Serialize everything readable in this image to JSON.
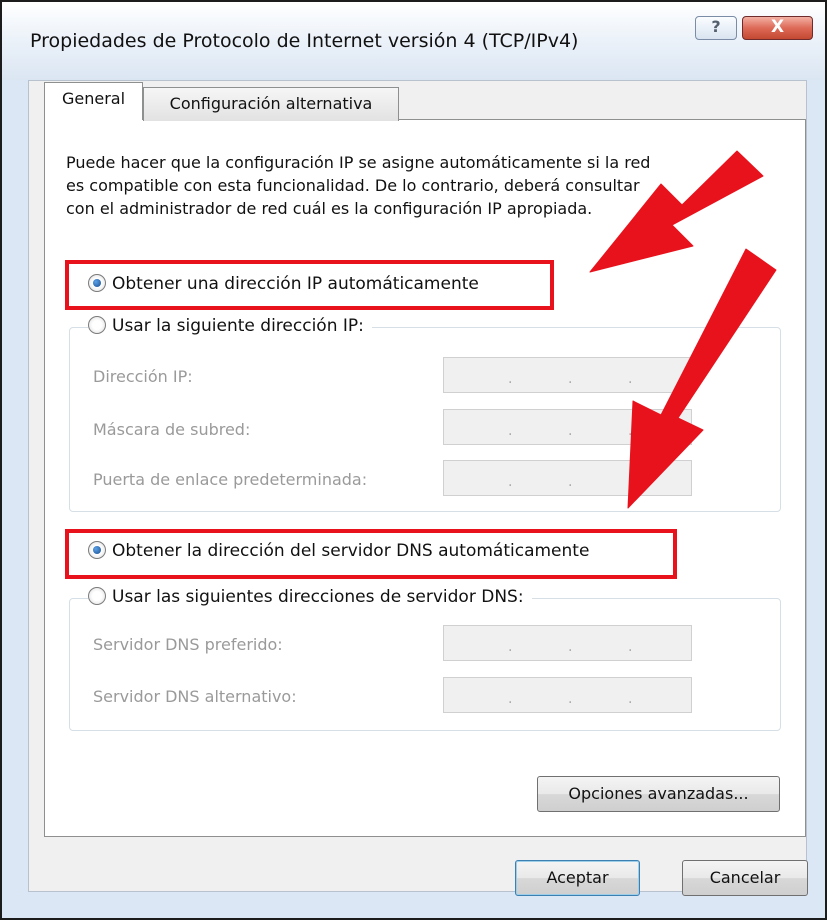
{
  "window": {
    "title": "Propiedades de Protocolo de Internet versión 4 (TCP/IPv4)",
    "help_label": "?",
    "close_label": "X"
  },
  "tabs": [
    {
      "label": "General",
      "selected": true
    },
    {
      "label": "Configuración alternativa",
      "selected": false
    }
  ],
  "intro_lines": [
    "Puede hacer que la configuración IP se asigne automáticamente si la red",
    "es compatible con esta funcionalidad. De lo contrario, deberá consultar",
    "con el administrador de red cuál es la configuración IP apropiada."
  ],
  "ip_section": {
    "auto_label": "Obtener una dirección IP automáticamente",
    "auto_selected": true,
    "manual_label": "Usar la siguiente dirección IP:",
    "fields": [
      {
        "label": "Dirección IP:",
        "value": ". . ."
      },
      {
        "label": "Máscara de subred:",
        "value": ". . ."
      },
      {
        "label": "Puerta de enlace predeterminada:",
        "value": ". . ."
      }
    ]
  },
  "dns_section": {
    "auto_label": "Obtener la dirección del servidor DNS automáticamente",
    "auto_selected": true,
    "manual_label": "Usar las siguientes direcciones de servidor DNS:",
    "fields": [
      {
        "label": "Servidor DNS preferido:",
        "value": ". . ."
      },
      {
        "label": "Servidor DNS alternativo:",
        "value": ". . ."
      }
    ]
  },
  "buttons": {
    "advanced": "Opciones avanzadas...",
    "ok": "Aceptar",
    "cancel": "Cancelar"
  },
  "colors": {
    "highlight": "#e8121c",
    "arrow": "#e8121c"
  }
}
